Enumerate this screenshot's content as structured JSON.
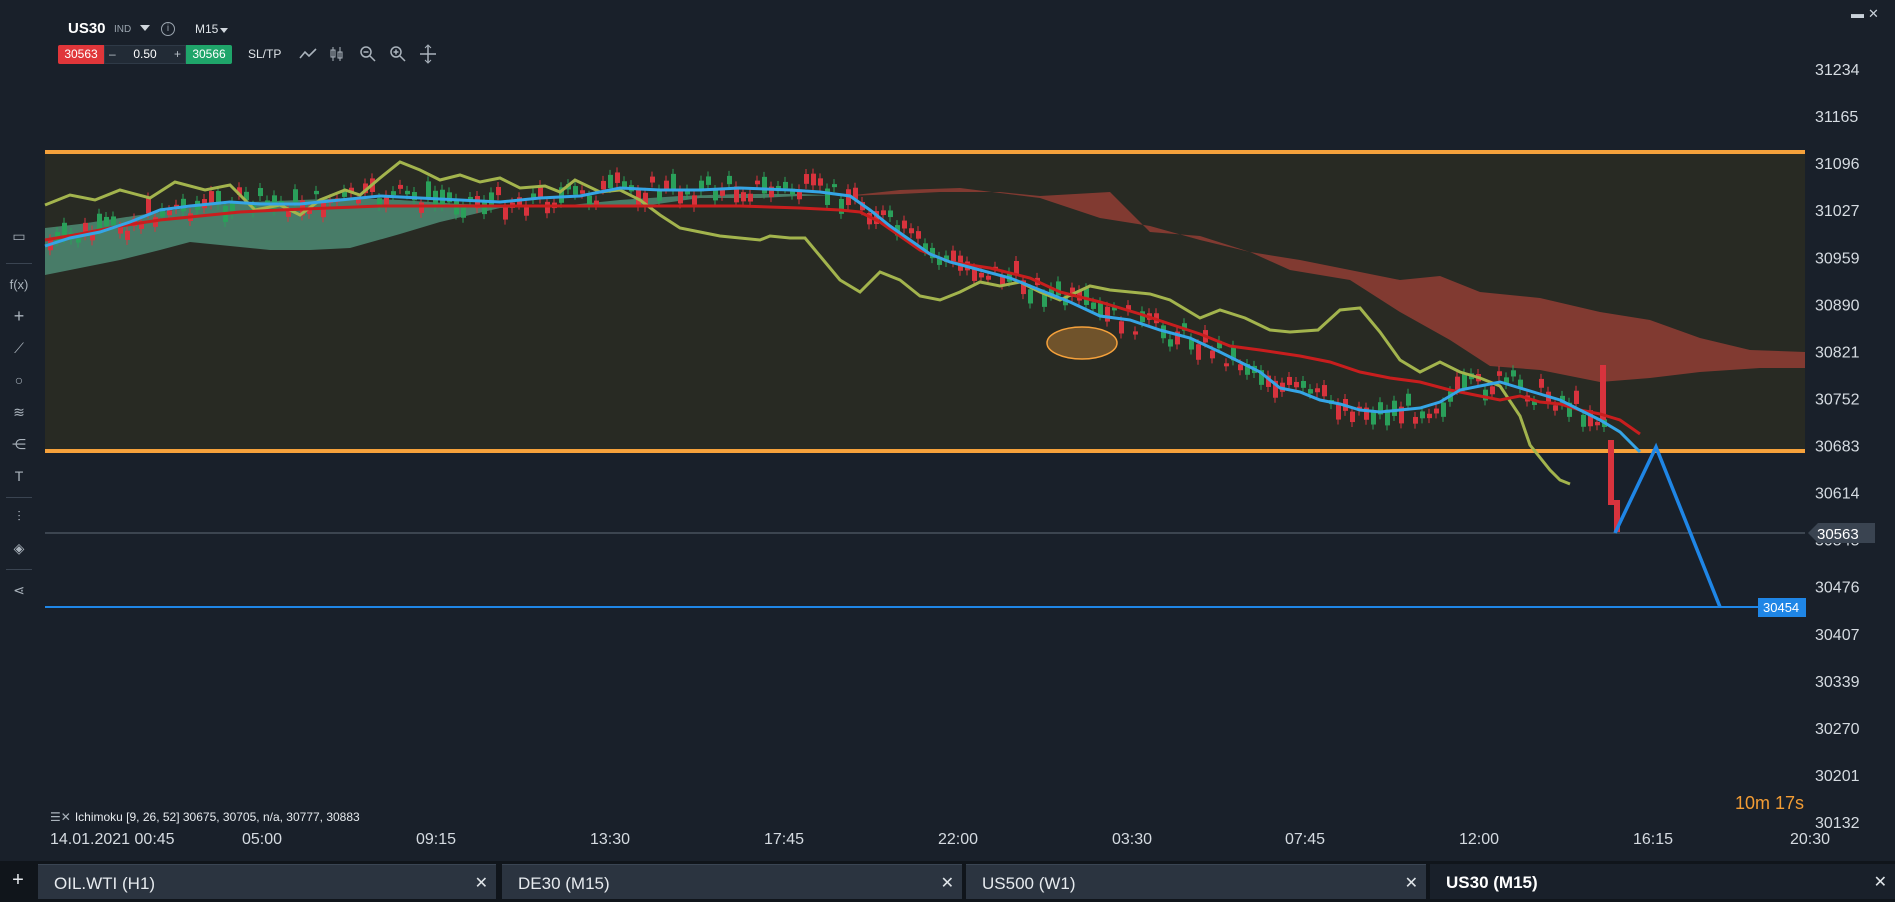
{
  "toolbar": {
    "symbol": "US30",
    "symbol_type": "IND",
    "timeframe": "M15",
    "sell_price": "30563",
    "minus": "–",
    "quantity": "0.50",
    "plus": "+",
    "buy_price": "30566",
    "sltp_label": "SL/TP",
    "icons": [
      "line-chart-icon",
      "candles-icon",
      "zoom-out-icon",
      "zoom-in-icon",
      "crosshair-icon"
    ]
  },
  "left_tools": [
    {
      "name": "rectangle-icon",
      "glyph": "▭"
    },
    {
      "name": "function-icon",
      "glyph": "f(x)"
    },
    {
      "name": "crosshair-add-icon",
      "glyph": "+"
    },
    {
      "name": "trendline-icon",
      "glyph": "⟋"
    },
    {
      "name": "circle-icon",
      "glyph": "○"
    },
    {
      "name": "fibonacci-icon",
      "glyph": "≋"
    },
    {
      "name": "pitchfork-icon",
      "glyph": "⋲"
    },
    {
      "name": "text-icon",
      "glyph": "T"
    },
    {
      "name": "indicators-icon",
      "glyph": "⫶"
    },
    {
      "name": "layers-icon",
      "glyph": "◈"
    },
    {
      "name": "share-icon",
      "glyph": "⋖"
    }
  ],
  "window": {
    "restore": "▬",
    "close": "✕"
  },
  "chart_data": {
    "type": "candlestick",
    "symbol": "US30",
    "timeframe": "M15",
    "y_ticks": [
      31234,
      31165,
      31096,
      31027,
      30959,
      30890,
      30821,
      30752,
      30683,
      30614,
      30545,
      30476,
      30407,
      30339,
      30270,
      30201,
      30132
    ],
    "ylim": [
      30132,
      31234
    ],
    "x_ticks": [
      "14.01.2021 00:45",
      "05:00",
      "09:15",
      "13:30",
      "17:45",
      "22:00",
      "03:30",
      "07:45",
      "12:00",
      "16:15",
      "20:30"
    ],
    "current_price": "30563",
    "target_level": "30454",
    "resistance_level": 31096,
    "support_level": 30683,
    "projection_path": [
      [
        30563
      ],
      [
        30690
      ],
      [
        30454
      ]
    ],
    "indicator": {
      "name": "Ichimoku",
      "params": "[9, 26, 52]",
      "values": "30675, 30705, n/a, 30777, 30883",
      "legend": "Ichimoku [9, 26, 52] 30675, 30705, n/a, 30777, 30883"
    },
    "colors": {
      "background": "#19202a",
      "resistance_support": "#f5a13b",
      "target_line": "#1f86e6",
      "tenkan": "#35a5e6",
      "kijun": "#c81e1e",
      "chikou": "#a3b44d",
      "kumo_bull": "#4d8b74",
      "kumo_bear": "#8b3c33",
      "candle_up": "#2aa05a",
      "candle_down": "#d8333d"
    }
  },
  "countdown": {
    "minutes": "10m",
    "seconds": "17s"
  },
  "tabs": [
    {
      "label": "OIL.WTI (H1)",
      "active": false
    },
    {
      "label": "DE30 (M15)",
      "active": false
    },
    {
      "label": "US500 (W1)",
      "active": false
    },
    {
      "label": "US30 (M15)",
      "active": true
    }
  ],
  "tab_add": "+",
  "tab_close": "✕"
}
